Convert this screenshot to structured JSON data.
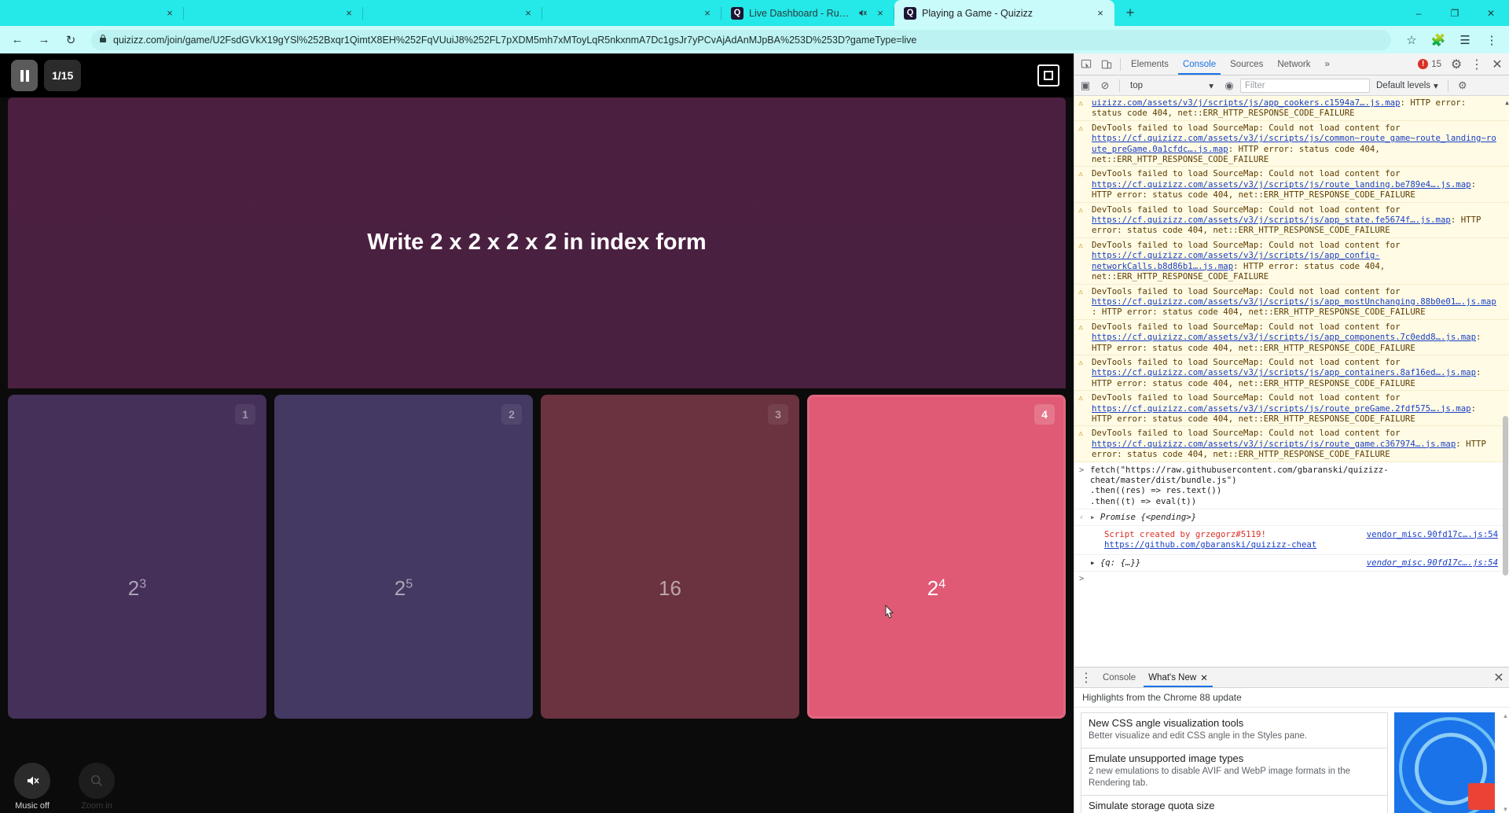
{
  "browser": {
    "tabs": [
      {
        "title": "",
        "favicon": "",
        "muted": false,
        "active": false,
        "close_label": "×"
      },
      {
        "title": "",
        "favicon": "",
        "muted": false,
        "active": false,
        "close_label": "×"
      },
      {
        "title": "",
        "favicon": "",
        "muted": false,
        "active": false,
        "close_label": "×"
      },
      {
        "title": "",
        "favicon": "",
        "muted": false,
        "active": false,
        "close_label": "×"
      },
      {
        "title": "Live Dashboard - Running",
        "favicon": "Q",
        "muted": true,
        "active": false,
        "close_label": "×"
      },
      {
        "title": "Playing a Game - Quizizz",
        "favicon": "Q",
        "muted": false,
        "active": true,
        "close_label": "×"
      }
    ],
    "new_tab_label": "+",
    "window_controls": {
      "minimize": "–",
      "maximize": "❐",
      "close": "✕"
    },
    "toolbar": {
      "back": "←",
      "forward": "→",
      "reload": "↻",
      "lock_icon": "🔒",
      "url": "quizizz.com/join/game/U2FsdGVkX19gYSl%252Bxqr1QimtX8EH%252FqVUuiJ8%252FL7pXDM5mh7xMToyLqR5nkxnmA7Dc1gsJr7yPCvAjAdAnMJpBA%253D%253D?gameType=live",
      "star": "☆",
      "extensions": "🧩",
      "profile": "☰",
      "menu": "⋮"
    }
  },
  "game": {
    "pause_label": "pause",
    "question_counter": "1/15",
    "fullscreen_label": "fullscreen",
    "question": "Write 2 x 2 x 2 x 2 in index form",
    "answers": [
      {
        "num": "1",
        "base": "2",
        "exp": "3",
        "selected": false
      },
      {
        "num": "2",
        "base": "2",
        "exp": "5",
        "selected": false
      },
      {
        "num": "3",
        "base": "16",
        "exp": "",
        "selected": false
      },
      {
        "num": "4",
        "base": "2",
        "exp": "4",
        "selected": true
      }
    ],
    "bottom_buttons": [
      {
        "label": "Music off",
        "icon": "🔇",
        "dim": false
      },
      {
        "label": "Zoom in",
        "icon": "🔍",
        "dim": true
      }
    ],
    "colors": {
      "answer1": "#443059",
      "answer2": "#443962",
      "answer3": "#6b333f",
      "answer4_selected": "#e05a75",
      "question_panel": "#4b1f3f"
    }
  },
  "devtools": {
    "tabs": [
      {
        "label": "Elements",
        "active": false
      },
      {
        "label": "Console",
        "active": true
      },
      {
        "label": "Sources",
        "active": false
      },
      {
        "label": "Network",
        "active": false
      }
    ],
    "more_tabs_label": "»",
    "error_count": "15",
    "error_badge_glyph": "!",
    "settings_label": "⚙",
    "more_label": "⋮",
    "close_label": "✕",
    "inspect_icon": "inspect",
    "device_icon": "device",
    "console_toolbar": {
      "sidebar_label": "▣",
      "clear_label": "⊘",
      "context": "top",
      "context_caret": "▾",
      "eye_label": "◉",
      "filter_placeholder": "Filter",
      "filter_value": "",
      "levels": "Default levels",
      "levels_caret": "▾",
      "settings": "⚙"
    },
    "messages": [
      {
        "type": "warning",
        "icon": "⚠",
        "parts": [
          {
            "t": "uizizz.com/assets/v3/j/scripts/js/app_cookers.c1594a7….js.map",
            "link": true
          },
          {
            "t": ": HTTP error: status code 404, net::ERR_HTTP_RESPONSE_CODE_FAILURE",
            "link": false
          }
        ],
        "clipped_top": true
      },
      {
        "type": "warning",
        "icon": "⚠",
        "parts": [
          {
            "t": "DevTools failed to load SourceMap: Could not load content for ",
            "link": false
          },
          {
            "t": "https://cf.quizizz.com/assets/v3/j/scripts/js/common~route_game~route_landing~route_preGame.0a1cfdc….js.map",
            "link": true
          },
          {
            "t": ": HTTP error: status code 404, net::ERR_HTTP_RESPONSE_CODE_FAILURE",
            "link": false
          }
        ]
      },
      {
        "type": "warning",
        "icon": "⚠",
        "parts": [
          {
            "t": "DevTools failed to load SourceMap: Could not load content for ",
            "link": false
          },
          {
            "t": "https://cf.quizizz.com/assets/v3/j/scripts/js/route_landing.be789e4….js.map",
            "link": true
          },
          {
            "t": ": HTTP error: status code 404, net::ERR_HTTP_RESPONSE_CODE_FAILURE",
            "link": false
          }
        ]
      },
      {
        "type": "warning",
        "icon": "⚠",
        "parts": [
          {
            "t": "DevTools failed to load SourceMap: Could not load content for ",
            "link": false
          },
          {
            "t": "https://cf.quizizz.com/assets/v3/j/scripts/js/app_state.fe5674f….js.map",
            "link": true
          },
          {
            "t": ": HTTP error: status code 404, net::ERR_HTTP_RESPONSE_CODE_FAILURE",
            "link": false
          }
        ]
      },
      {
        "type": "warning",
        "icon": "⚠",
        "parts": [
          {
            "t": "DevTools failed to load SourceMap: Could not load content for ",
            "link": false
          },
          {
            "t": "https://cf.quizizz.com/assets/v3/j/scripts/js/app_config-networkCalls.b8d86b1….js.map",
            "link": true
          },
          {
            "t": ": HTTP error: status code 404, net::ERR_HTTP_RESPONSE_CODE_FAILURE",
            "link": false
          }
        ]
      },
      {
        "type": "warning",
        "icon": "⚠",
        "parts": [
          {
            "t": "DevTools failed to load SourceMap: Could not load content for ",
            "link": false
          },
          {
            "t": "https://cf.quizizz.com/assets/v3/j/scripts/js/app_mostUnchanging.88b0e01….js.map",
            "link": true
          },
          {
            "t": ": HTTP error: status code 404, net::ERR_HTTP_RESPONSE_CODE_FAILURE",
            "link": false
          }
        ]
      },
      {
        "type": "warning",
        "icon": "⚠",
        "parts": [
          {
            "t": "DevTools failed to load SourceMap: Could not load content for ",
            "link": false
          },
          {
            "t": "https://cf.quizizz.com/assets/v3/j/scripts/js/app_components.7c0edd8….js.map",
            "link": true
          },
          {
            "t": ": HTTP error: status code 404, net::ERR_HTTP_RESPONSE_CODE_FAILURE",
            "link": false
          }
        ]
      },
      {
        "type": "warning",
        "icon": "⚠",
        "parts": [
          {
            "t": "DevTools failed to load SourceMap: Could not load content for ",
            "link": false
          },
          {
            "t": "https://cf.quizizz.com/assets/v3/j/scripts/js/app_containers.8af16ed….js.map",
            "link": true
          },
          {
            "t": ": HTTP error: status code 404, net::ERR_HTTP_RESPONSE_CODE_FAILURE",
            "link": false
          }
        ]
      },
      {
        "type": "warning",
        "icon": "⚠",
        "parts": [
          {
            "t": "DevTools failed to load SourceMap: Could not load content for ",
            "link": false
          },
          {
            "t": "https://cf.quizizz.com/assets/v3/j/scripts/js/route_preGame.2fdf575….js.map",
            "link": true
          },
          {
            "t": ": HTTP error: status code 404, net::ERR_HTTP_RESPONSE_CODE_FAILURE",
            "link": false
          }
        ]
      },
      {
        "type": "warning",
        "icon": "⚠",
        "parts": [
          {
            "t": "DevTools failed to load SourceMap: Could not load content for ",
            "link": false
          },
          {
            "t": "https://cf.quizizz.com/assets/v3/j/scripts/js/route_game.c367974….js.map",
            "link": true
          },
          {
            "t": ": HTTP error: status code 404, net::ERR_HTTP_RESPONSE_CODE_FAILURE",
            "link": false
          }
        ]
      }
    ],
    "input_expression": "fetch(\"https://raw.githubusercontent.com/gbaranski/quizizz-cheat/master/dist/bundle.js\")\n.then((res) => res.text())\n.then((t) => eval(t))",
    "input_caret": ">",
    "result_caret": "‹",
    "result_triangle": "▸",
    "result_value": "Promise {<pending>}",
    "log_source": "vendor_misc.90fd17c….js:54",
    "log_line1": "Script created by grzegorz#5119!",
    "log_line2": "https://github.com/gbaranski/quizizz-cheat",
    "object_source": "vendor_misc.90fd17c….js:54",
    "object_value": "{q: {…}}",
    "object_triangle": "▸",
    "prompt_caret": ">",
    "drawer": {
      "menu_icon": "⋮",
      "tabs": [
        {
          "label": "Console",
          "active": false,
          "closable": false
        },
        {
          "label": "What's New",
          "active": true,
          "closable": true
        }
      ],
      "close_label": "✕",
      "tab_close_label": "✕",
      "subtitle": "Highlights from the Chrome 88 update",
      "cards": [
        {
          "title": "New CSS angle visualization tools",
          "desc": "Better visualize and edit CSS angle in the Styles pane."
        },
        {
          "title": "Emulate unsupported image types",
          "desc": "2 new emulations to disable AVIF and WebP image formats in the Rendering tab."
        },
        {
          "title": "Simulate storage quota size",
          "desc": ""
        }
      ],
      "scroll_up": "▲",
      "scroll_down": "▼"
    }
  }
}
